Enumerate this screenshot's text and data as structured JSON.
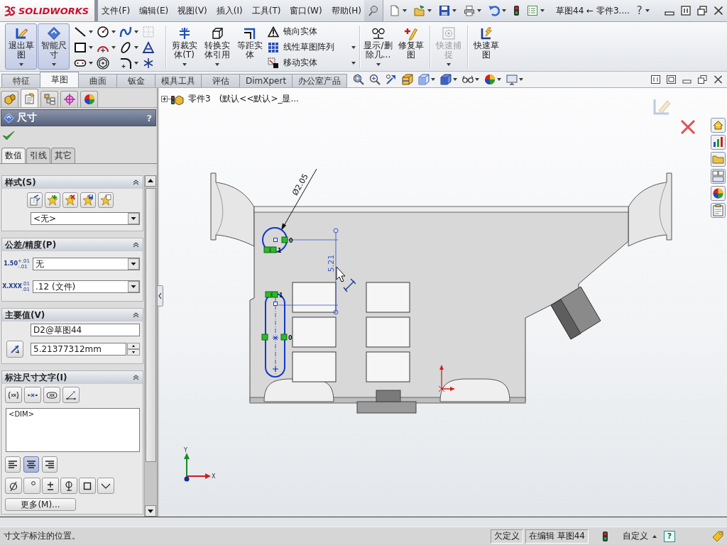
{
  "app_bar": {
    "logo_text": "SOLIDWORKS",
    "menus": [
      "文件(F)",
      "编辑(E)",
      "视图(V)",
      "插入(I)",
      "工具(T)",
      "窗口(W)",
      "帮助(H)"
    ],
    "document_title": "草图44 ← 零件3....",
    "help_glyph": "?"
  },
  "command_manager": {
    "sketch_buttons": [
      {
        "label": "退出草图",
        "pressed": true,
        "dropdown": true,
        "disabled": false
      },
      {
        "label": "智能尺寸",
        "pressed": true,
        "dropdown": true,
        "disabled": false
      }
    ],
    "entity_buttons": [
      {
        "label": "剪裁实体(T)",
        "pressed": false,
        "dropdown": true,
        "disabled": false
      },
      {
        "label": "转换实体引用",
        "pressed": false,
        "dropdown": true,
        "disabled": false
      },
      {
        "label": "等距实体",
        "pressed": false,
        "dropdown": false,
        "disabled": false
      }
    ],
    "entity_list": [
      {
        "label": "镜向实体",
        "dropdown": false
      },
      {
        "label": "线性草图阵列",
        "dropdown": true
      },
      {
        "label": "移动实体",
        "dropdown": true
      }
    ],
    "display_buttons": [
      {
        "label": "显示/删除几...",
        "pressed": false,
        "dropdown": true,
        "disabled": false
      },
      {
        "label": "修复草图",
        "pressed": false,
        "dropdown": false,
        "disabled": false
      },
      {
        "label": "快速捕捉",
        "pressed": false,
        "dropdown": true,
        "disabled": true
      },
      {
        "label": "快速草图",
        "pressed": false,
        "dropdown": false,
        "disabled": false
      }
    ]
  },
  "feature_tabs": [
    {
      "label": "特征",
      "selected": false
    },
    {
      "label": "草图",
      "selected": true
    },
    {
      "label": "曲面",
      "selected": false
    },
    {
      "label": "钣金",
      "selected": false
    },
    {
      "label": "模具工具",
      "selected": false
    },
    {
      "label": "评估",
      "selected": false
    },
    {
      "label": "DimXpert",
      "selected": false
    },
    {
      "label": "办公室产品",
      "selected": false
    }
  ],
  "property_manager": {
    "panel_tabs": [
      {
        "selected": false
      },
      {
        "selected": true
      },
      {
        "selected": false
      },
      {
        "selected": false
      },
      {
        "selected": false
      }
    ],
    "title": "尺寸",
    "help_glyph": "?",
    "subtabs": [
      {
        "label": "数值",
        "selected": true
      },
      {
        "label": "引线",
        "selected": false
      },
      {
        "label": "其它",
        "selected": false
      }
    ],
    "sections": {
      "style": {
        "title": "样式(S)",
        "style_value": "<无>"
      },
      "tolerance": {
        "title": "公差/精度(P)",
        "tolerance_sample": {
          "value": "1.50",
          "upper": "+.01",
          "lower": "-.01"
        },
        "tolerance_value": "无",
        "precision_sample": {
          "value": "X.XXX",
          "upper": ".01",
          "lower": ".01"
        },
        "precision_value": ".12 (文件)"
      },
      "primary_value": {
        "title": "主要值(V)",
        "name": "D2@草图44",
        "value": "5.21377312mm"
      },
      "dimension_text": {
        "title": "标注尺寸文字(I)",
        "text": "<DIM>",
        "alignment": [
          {
            "selected": false
          },
          {
            "selected": true
          },
          {
            "selected": false
          }
        ],
        "more_button": "更多(M)..."
      }
    }
  },
  "feature_tree": {
    "part_name": "零件3",
    "configuration": "(默认<<默认>_显..."
  },
  "canvas": {
    "diameter_dimension": "Ø2.05",
    "linear_dimension": "5.21",
    "relation_labels": [
      "0",
      "1",
      "1",
      "0"
    ],
    "triad": {
      "x_label": "X",
      "y_label": "Y"
    }
  },
  "status_bar": {
    "message": "寸文字标注的位置。",
    "definition": "欠定义",
    "editing": "在编辑 草图44",
    "units": "自定义",
    "help_glyph": "?"
  }
}
